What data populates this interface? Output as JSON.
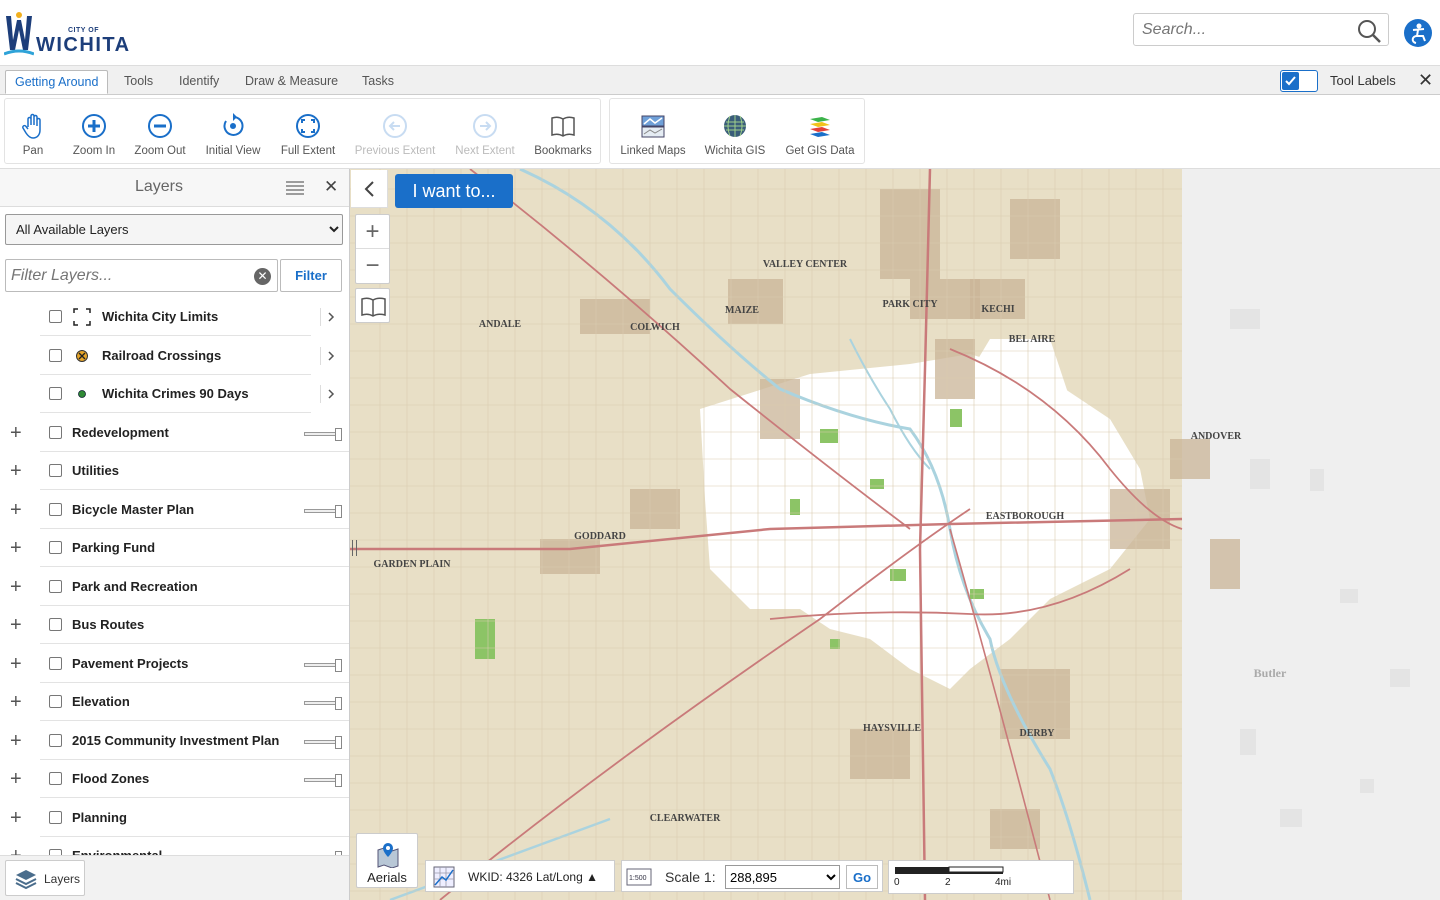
{
  "header": {
    "logo_small": "CITY OF",
    "logo_main": "WICHITA",
    "search_placeholder": "Search..."
  },
  "tabs": [
    {
      "label": "Getting Around",
      "active": true
    },
    {
      "label": "Tools",
      "active": false
    },
    {
      "label": "Identify",
      "active": false
    },
    {
      "label": "Draw & Measure",
      "active": false
    },
    {
      "label": "Tasks",
      "active": false
    }
  ],
  "tool_labels_toggle": {
    "label": "Tool Labels",
    "checked": true
  },
  "toolbar": {
    "navigation": [
      {
        "label": "Pan",
        "icon": "hand-icon",
        "enabled": true
      },
      {
        "label": "Zoom In",
        "icon": "zoom-in-icon",
        "enabled": true
      },
      {
        "label": "Zoom Out",
        "icon": "zoom-out-icon",
        "enabled": true
      },
      {
        "label": "Initial View",
        "icon": "initial-view-icon",
        "enabled": true
      },
      {
        "label": "Full Extent",
        "icon": "full-extent-icon",
        "enabled": true
      },
      {
        "label": "Previous Extent",
        "icon": "previous-extent-icon",
        "enabled": false
      },
      {
        "label": "Next Extent",
        "icon": "next-extent-icon",
        "enabled": false
      },
      {
        "label": "Bookmarks",
        "icon": "book-icon",
        "enabled": true
      }
    ],
    "links": [
      {
        "label": "Linked Maps",
        "icon": "linked-maps-icon"
      },
      {
        "label": "Wichita GIS",
        "icon": "globe-icon"
      },
      {
        "label": "Get GIS Data",
        "icon": "layers-data-icon"
      }
    ]
  },
  "panel": {
    "title": "Layers",
    "layer_select": "All Available Layers",
    "filter_placeholder": "Filter Layers...",
    "filter_button": "Filter",
    "footer_tab": "Layers"
  },
  "layers": [
    {
      "name": "Wichita City Limits",
      "child": true,
      "icon": "city-limits-icon"
    },
    {
      "name": "Railroad Crossings",
      "child": true,
      "icon": "railroad-crossing-icon"
    },
    {
      "name": "Wichita Crimes 90 Days",
      "child": true,
      "icon": "green-dot-icon"
    },
    {
      "name": "Redevelopment",
      "child": false,
      "slider": true
    },
    {
      "name": "Utilities",
      "child": false,
      "slider": false
    },
    {
      "name": "Bicycle Master Plan",
      "child": false,
      "slider": true
    },
    {
      "name": "Parking Fund",
      "child": false,
      "slider": false
    },
    {
      "name": "Park and Recreation",
      "child": false,
      "slider": false
    },
    {
      "name": "Bus Routes",
      "child": false,
      "slider": false
    },
    {
      "name": "Pavement Projects",
      "child": false,
      "slider": true
    },
    {
      "name": "Elevation",
      "child": false,
      "slider": true
    },
    {
      "name": "2015 Community Investment Plan",
      "child": false,
      "slider": true
    },
    {
      "name": "Flood Zones",
      "child": false,
      "slider": true
    },
    {
      "name": "Planning",
      "child": false,
      "slider": false
    },
    {
      "name": "Environmental",
      "child": false,
      "slider": true
    }
  ],
  "map": {
    "i_want_to": "I want to...",
    "aerials": "Aerials",
    "coords": "WKID: 4326 Lat/Long ▲",
    "scale_label": "Scale 1:",
    "scale_value": "288,895",
    "go": "Go",
    "scalebar_labels": [
      "0",
      "2",
      "4mi"
    ],
    "places": [
      {
        "name": "VALLEY CENTER"
      },
      {
        "name": "PARK CITY"
      },
      {
        "name": "KECHI"
      },
      {
        "name": "BEL AIRE"
      },
      {
        "name": "MAIZE"
      },
      {
        "name": "COLWICH"
      },
      {
        "name": "ANDALE"
      },
      {
        "name": "GODDARD"
      },
      {
        "name": "GARDEN PLAIN"
      },
      {
        "name": "EASTBOROUGH"
      },
      {
        "name": "ANDOVER"
      },
      {
        "name": "HAYSVILLE"
      },
      {
        "name": "DERBY"
      },
      {
        "name": "CLEARWATER"
      },
      {
        "name": "Butler"
      }
    ],
    "colors": {
      "agri": "#e8dfc6",
      "urban": "#ffffff",
      "towns": "#c9b497",
      "roads": "#c97a7a",
      "water": "#aad3df",
      "park": "#8cc466"
    }
  }
}
